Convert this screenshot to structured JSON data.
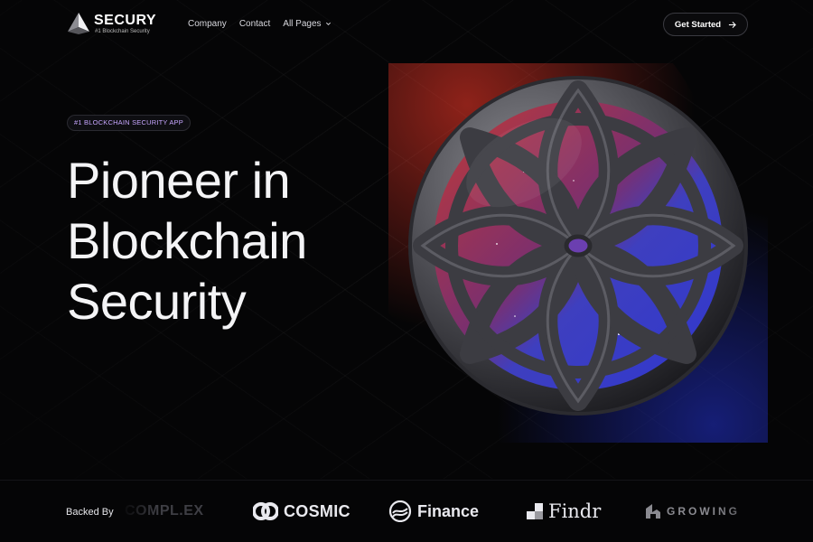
{
  "brand": {
    "name": "SECURY",
    "tagline": "#1 Blockchain Security"
  },
  "nav": {
    "items": [
      {
        "label": "Company"
      },
      {
        "label": "Contact"
      },
      {
        "label": "All Pages"
      }
    ]
  },
  "header": {
    "cta_label": "Get Started"
  },
  "hero": {
    "badge": "#1 BLOCKCHAIN SECURITY APP",
    "title_lines": [
      "Pioneer in",
      "Blockchain",
      "Security"
    ]
  },
  "backed": {
    "label": "Backed By",
    "partners": [
      {
        "name": "COMPL.EX",
        "icon": "complex-logo-icon"
      },
      {
        "name": "COSMIC",
        "icon": "cosmic-logo-icon"
      },
      {
        "name": "Finance",
        "icon": "finance-logo-icon"
      },
      {
        "name": "Findr",
        "icon": "findr-logo-icon"
      },
      {
        "name": "GROWING",
        "icon": "growing-logo-icon"
      }
    ]
  },
  "colors": {
    "background": "#050506",
    "badge_text": "#c7a6ff",
    "sphere_red": "#c0343a",
    "sphere_blue": "#3b3fd8"
  }
}
